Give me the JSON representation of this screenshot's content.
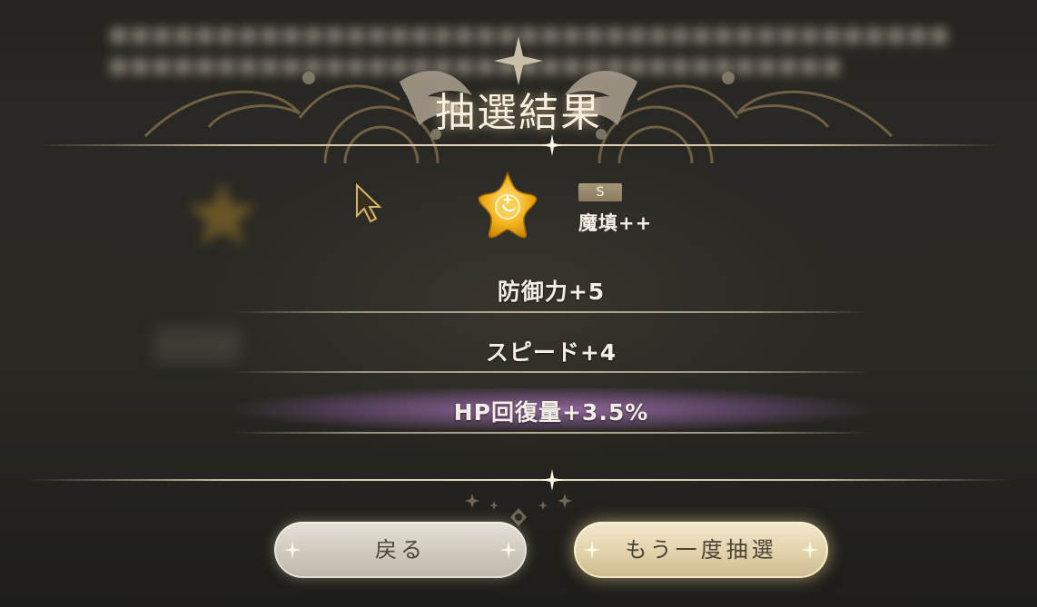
{
  "dialog": {
    "title": "抽選結果"
  },
  "result": {
    "rank": "S",
    "item_name": "魔填++",
    "icon": "gold-star-emblem-icon"
  },
  "stats": [
    {
      "label": "防御力+5",
      "highlighted": false
    },
    {
      "label": "スピード+4",
      "highlighted": false
    },
    {
      "label": "HP回復量+3.5%",
      "highlighted": true
    }
  ],
  "buttons": {
    "back_label": "戻る",
    "redraw_label": "もう一度抽選"
  },
  "colors": {
    "highlight_purple": "#96699f",
    "gold_accent": "#e9d9b0",
    "rank_badge": "#9a8c6e",
    "text_light": "#f4efe6"
  }
}
